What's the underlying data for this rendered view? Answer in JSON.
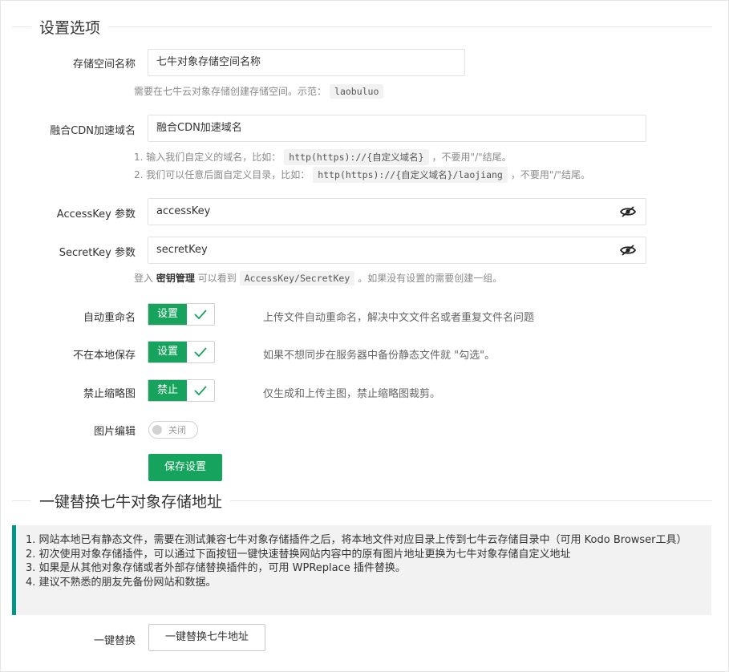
{
  "section1": {
    "title": "设置选项"
  },
  "bucket": {
    "label": "存储空间名称",
    "value": "七牛对象存储空间名称",
    "hint_prefix": "需要在七牛云对象存储创建存储空间。示范：",
    "hint_code": "laobuluo"
  },
  "cdn": {
    "label": "融合CDN加速域名",
    "value": "融合CDN加速域名",
    "hint1_prefix": "1. 输入我们自定义的域名，比如：",
    "hint1_code": "http(https)://{自定义域名}",
    "hint1_suffix": "，不要用\"/\"结尾。",
    "hint2_prefix": "2. 我们可以任意后面自定义目录，比如：",
    "hint2_code": "http(https)://{自定义域名}/laojiang",
    "hint2_suffix": "，不要用\"/\"结尾。"
  },
  "accesskey": {
    "label": "AccessKey 参数",
    "value": "accessKey"
  },
  "secretkey": {
    "label": "SecretKey 参数",
    "value": "secretKey"
  },
  "keys_hint": {
    "prefix": "登入",
    "bold": "密钥管理",
    "middle": "可以看到",
    "code": "AccessKey/SecretKey",
    "suffix": "。如果没有设置的需要创建一组。"
  },
  "auto_rename": {
    "label": "自动重命名",
    "check_label": "设置",
    "desc": "上传文件自动重命名，解决中文文件名或者重复文件名问题"
  },
  "no_local": {
    "label": "不在本地保存",
    "check_label": "设置",
    "desc": "如果不想同步在服务器中备份静态文件就 \"勾选\"。"
  },
  "no_thumb": {
    "label": "禁止缩略图",
    "check_label": "禁止",
    "desc": "仅生成和上传主图，禁止缩略图裁剪。"
  },
  "image_edit": {
    "label": "图片编辑",
    "switch_text": "关闭"
  },
  "save_button": "保存设置",
  "section2": {
    "title": "一键替换七牛对象存储地址"
  },
  "notice": {
    "line1": "1. 网站本地已有静态文件，需要在测试兼容七牛对象存储插件之后，将本地文件对应目录上传到七牛云存储目录中（可用 Kodo Browser工具）",
    "line2": "2. 初次使用对象存储插件，可以通过下面按钮一键快速替换网站内容中的原有图片地址更换为七牛对象存储自定义地址",
    "line3": "3. 如果是从其他对象存储或者外部存储替换插件的，可用 WPReplace 插件替换。",
    "line4": "4. 建议不熟悉的朋友先备份网站和数据。"
  },
  "replace": {
    "label": "一键替换",
    "button": "一键替换七牛地址"
  },
  "colors": {
    "primary": "#16a35d",
    "notice_border": "#009688"
  }
}
